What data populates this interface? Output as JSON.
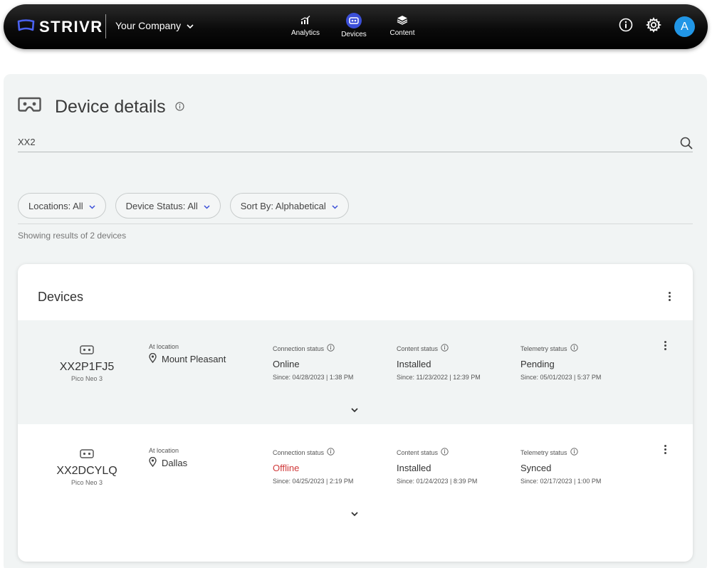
{
  "app": {
    "brand": "STRIVR",
    "company": "Your Company"
  },
  "nav": [
    {
      "label": "Analytics",
      "icon": "analytics-icon",
      "active": false
    },
    {
      "label": "Devices",
      "icon": "headset-icon",
      "active": true
    },
    {
      "label": "Content",
      "icon": "layers-icon",
      "active": false
    }
  ],
  "user": {
    "avatar_initial": "A"
  },
  "colors": {
    "accent": "#3b4fd8",
    "avatar": "#2196e6",
    "offline": "#d0393a",
    "panel": "#f1f4f4"
  },
  "page": {
    "title": "Device details"
  },
  "search": {
    "value": "XX2"
  },
  "filters": {
    "locations": "Locations: All",
    "device_status": "Device Status: All",
    "sort_by": "Sort By: Alphabetical"
  },
  "results_text": "Showing results of 2 devices",
  "devices_card": {
    "title": "Devices",
    "labels": {
      "location": "At location",
      "connection": "Connection status",
      "content": "Content status",
      "telemetry": "Telemetry status"
    },
    "rows": [
      {
        "name": "XX2P1FJ5",
        "model": "Pico Neo 3",
        "location": "Mount Pleasant",
        "connection": {
          "value": "Online",
          "since": "Since: 04/28/2023 | 1:38 PM"
        },
        "content": {
          "value": "Installed",
          "since": "Since: 11/23/2022 | 12:39 PM"
        },
        "telemetry": {
          "value": "Pending",
          "since": "Since: 05/01/2023 | 5:37 PM"
        }
      },
      {
        "name": "XX2DCYLQ",
        "model": "Pico Neo 3",
        "location": "Dallas",
        "connection": {
          "value": "Offline",
          "since": "Since: 04/25/2023 | 2:19 PM"
        },
        "content": {
          "value": "Installed",
          "since": "Since: 01/24/2023 | 8:39 PM"
        },
        "telemetry": {
          "value": "Synced",
          "since": "Since: 02/17/2023 | 1:00 PM"
        }
      }
    ]
  }
}
